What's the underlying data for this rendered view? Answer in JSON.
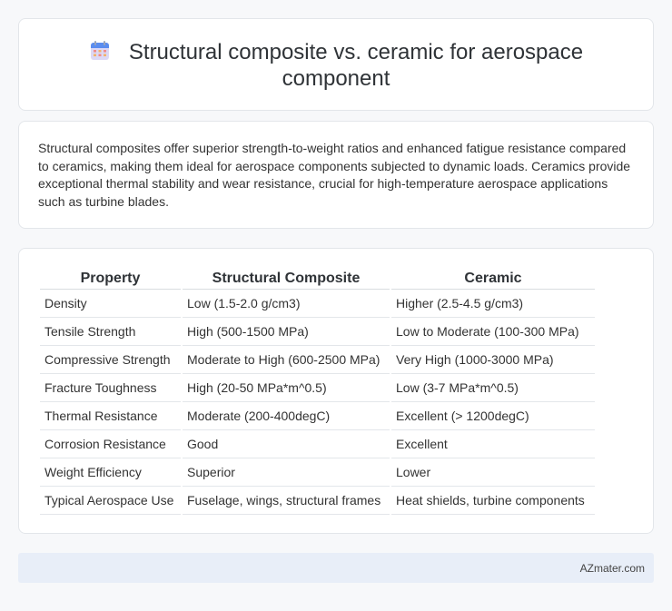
{
  "header": {
    "title": "Structural composite vs. ceramic for aerospace component",
    "icon": "calendar-icon"
  },
  "summary": {
    "text": "Structural composites offer superior strength-to-weight ratios and enhanced fatigue resistance compared to ceramics, making them ideal for aerospace components subjected to dynamic loads. Ceramics provide exceptional thermal stability and wear resistance, crucial for high-temperature aerospace applications such as turbine blades."
  },
  "table": {
    "headers": [
      "Property",
      "Structural Composite",
      "Ceramic"
    ],
    "rows": [
      [
        "Density",
        "Low (1.5-2.0 g/cm3)",
        "Higher (2.5-4.5 g/cm3)"
      ],
      [
        "Tensile Strength",
        "High (500-1500 MPa)",
        "Low to Moderate (100-300 MPa)"
      ],
      [
        "Compressive Strength",
        "Moderate to High (600-2500 MPa)",
        "Very High (1000-3000 MPa)"
      ],
      [
        "Fracture Toughness",
        "High (20-50 MPa*m^0.5)",
        "Low (3-7 MPa*m^0.5)"
      ],
      [
        "Thermal Resistance",
        "Moderate (200-400degC)",
        "Excellent (> 1200degC)"
      ],
      [
        "Corrosion Resistance",
        "Good",
        "Excellent"
      ],
      [
        "Weight Efficiency",
        "Superior",
        "Lower"
      ],
      [
        "Typical Aerospace Use",
        "Fuselage, wings, structural frames",
        "Heat shields, turbine components"
      ]
    ]
  },
  "footer": {
    "brand": "AZmater.com"
  }
}
